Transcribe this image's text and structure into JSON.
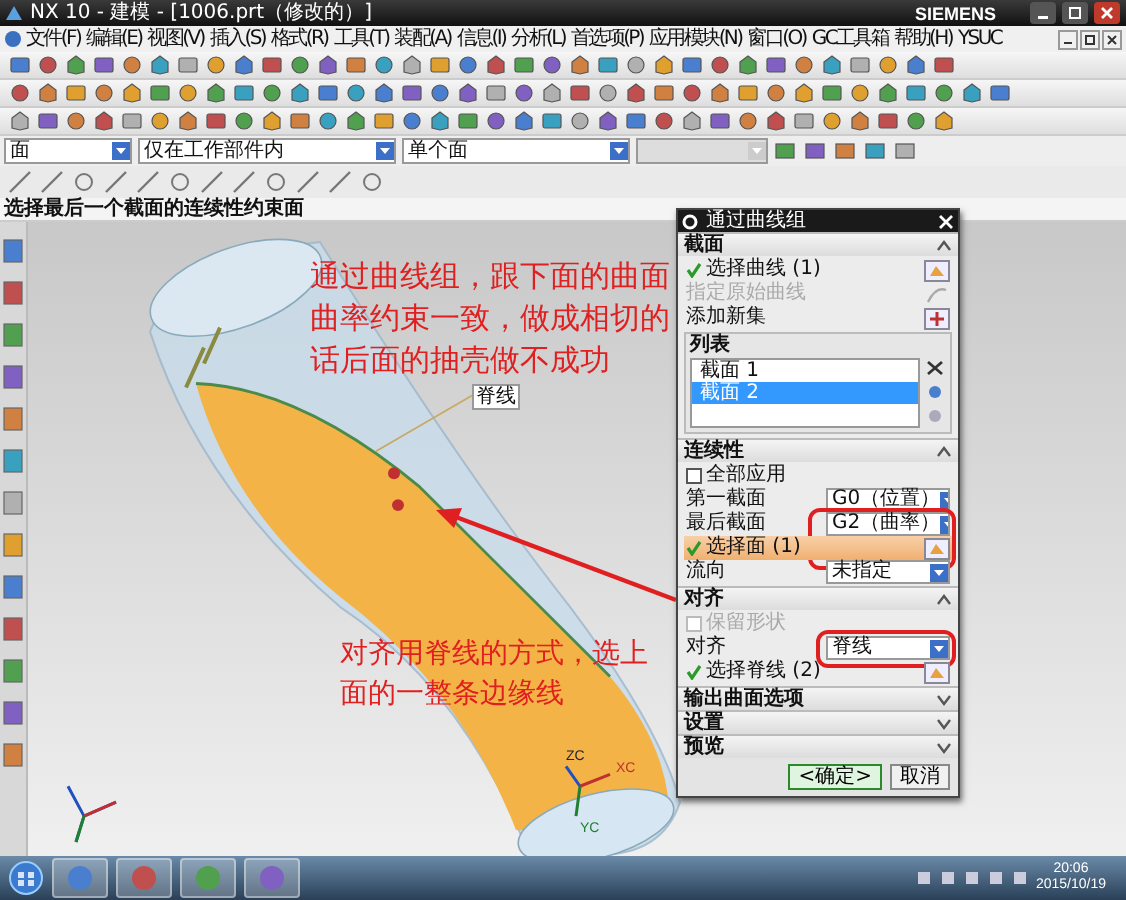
{
  "window": {
    "title": "NX 10 - 建模 - [1006.prt（修改的）]",
    "brand": "SIEMENS"
  },
  "menu": [
    "文件(F)",
    "编辑(E)",
    "视图(V)",
    "插入(S)",
    "格式(R)",
    "工具(T)",
    "装配(A)",
    "信息(I)",
    "分析(L)",
    "首选项(P)",
    "应用模块(N)",
    "窗口(O)",
    "GC工具箱",
    "帮助(H)",
    "YSUC"
  ],
  "selection_bar": {
    "filters": [
      {
        "value": "面",
        "disabled": false
      },
      {
        "value": "仅在工作部件内",
        "disabled": false
      },
      {
        "value": "单个面",
        "disabled": false
      },
      {
        "disabled": true
      }
    ]
  },
  "status_bar": {
    "prompt": "选择最后一个截面的连续性约束面"
  },
  "viewport": {
    "notes": [
      [
        "通过曲线组，跟下面的曲面",
        "曲率约束一致，做成相切的",
        "话后面的抽壳做不成功"
      ],
      [
        "对齐用脊线的方式，选上",
        "面的一整条边缘线"
      ]
    ],
    "tag": "脊线",
    "axes": [
      "ZC",
      "XC",
      "YC"
    ]
  },
  "dialog": {
    "title": "通过曲线组",
    "sections": [
      {
        "title": "截面",
        "expanded": true,
        "rows": [
          {
            "kind": "select",
            "label": "选择曲线 (1)",
            "active": false
          },
          {
            "kind": "text",
            "label": "指定原始曲线",
            "disabled": true
          },
          {
            "kind": "action",
            "label": "添加新集"
          },
          {
            "kind": "list",
            "title": "列表",
            "items": [
              {
                "label": "截面 1",
                "selected": false
              },
              {
                "label": "截面 2",
                "selected": true
              }
            ]
          }
        ]
      },
      {
        "title": "连续性",
        "expanded": true,
        "rows": [
          {
            "kind": "checkbox",
            "label": "全部应用",
            "checked": false,
            "disabled": false
          },
          {
            "kind": "combo",
            "label": "第一截面",
            "value": "G0（位置）"
          },
          {
            "kind": "combo",
            "label": "最后截面",
            "value": "G2（曲率）"
          },
          {
            "kind": "select",
            "label": "选择面 (1)",
            "active": true
          },
          {
            "kind": "combo",
            "label": "流向",
            "value": "未指定"
          }
        ]
      },
      {
        "title": "对齐",
        "expanded": true,
        "rows": [
          {
            "kind": "checkbox",
            "label": "保留形状",
            "checked": false,
            "disabled": true
          },
          {
            "kind": "combo",
            "label": "对齐",
            "value": "脊线"
          },
          {
            "kind": "select",
            "label": "选择脊线 (2)",
            "active": false
          }
        ]
      },
      {
        "title": "输出曲面选项",
        "expanded": false
      },
      {
        "title": "设置",
        "expanded": false
      },
      {
        "title": "预览",
        "expanded": false
      }
    ],
    "buttons": [
      "<确定>",
      "取消"
    ]
  },
  "taskbar": {
    "time": "20:06",
    "date": "2015/10/19"
  }
}
